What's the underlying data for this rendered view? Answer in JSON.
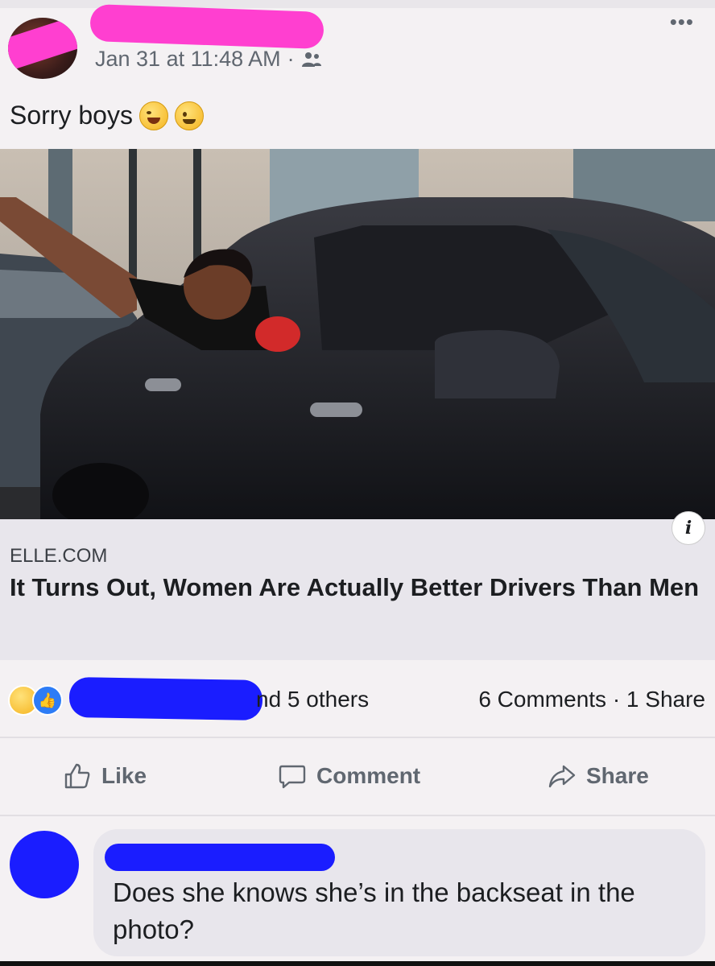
{
  "post": {
    "timestamp": "Jan 31 at 11:48 AM",
    "audience_icon": "friends-icon",
    "more_icon": "•••",
    "text": "Sorry boys",
    "emojis": [
      "laughing-emoji",
      "winking-emoji"
    ]
  },
  "link_card": {
    "domain": "ELLE.COM",
    "title": "It Turns Out, Women Are Actually Better Drivers Than Men",
    "info_icon": "i"
  },
  "reactions": {
    "icons": [
      "haha-reaction-icon",
      "like-reaction-icon"
    ],
    "others_text": "nd 5 others",
    "counts_text": "6 Comments · 1 Share"
  },
  "actions": {
    "like": "Like",
    "comment": "Comment",
    "share": "Share"
  },
  "comment": {
    "text": "Does she knows she’s in the backseat in the photo?"
  },
  "colors": {
    "redaction_pink": "#ff3fd0",
    "redaction_blue": "#1a1dff",
    "like_blue": "#2d7cf6"
  }
}
